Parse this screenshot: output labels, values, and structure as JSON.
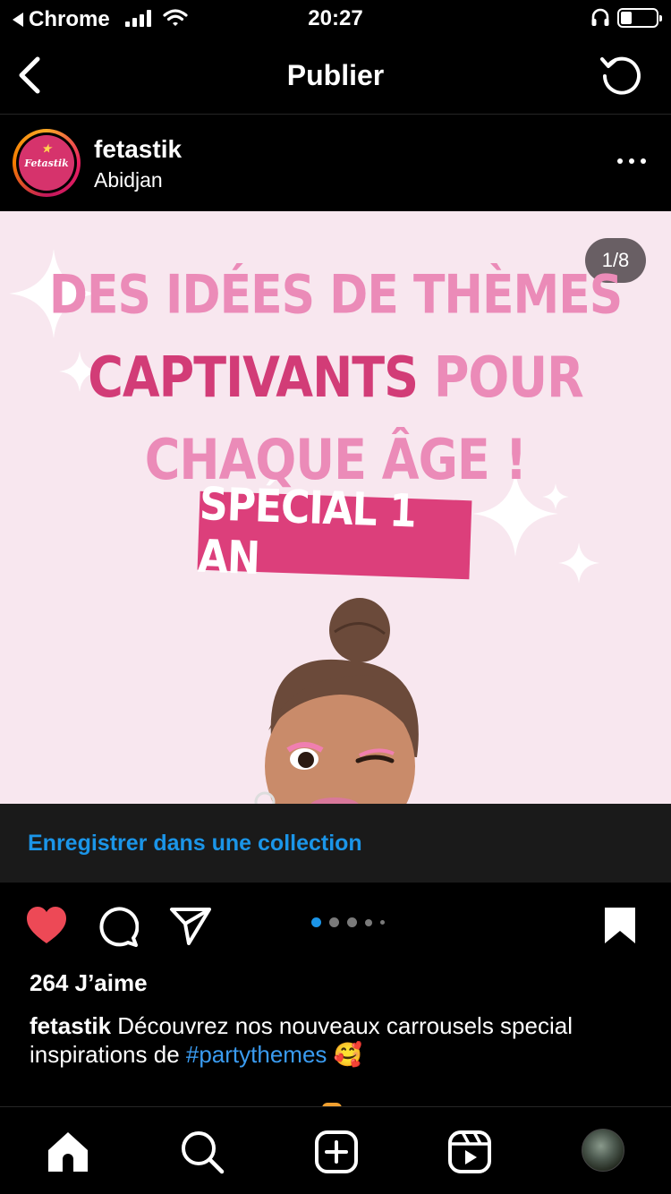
{
  "status_bar": {
    "back_app": "Chrome",
    "time": "20:27"
  },
  "nav": {
    "title": "Publier"
  },
  "post": {
    "username": "fetastik",
    "location": "Abidjan",
    "avatar_text": "Fetastik",
    "pager": "1/8",
    "image_text": {
      "line1": "DES IDÉES DE THÈMES",
      "line2_dark": "CAPTIVANTS",
      "line2_light": " POUR",
      "line3": "CHAQUE ÂGE !",
      "special": "SPÉCIAL 1 AN"
    },
    "carousel_dots": 5,
    "carousel_active_index": 0
  },
  "collection": {
    "label": "Enregistrer dans une collection"
  },
  "actions": {
    "liked": true,
    "saved": true
  },
  "meta": {
    "likes": "264 J’aime",
    "caption_user": "fetastik",
    "caption_text": " Découvrez nos nouveaux carrousels special inspirations de ",
    "caption_hashtag": "#partythemes",
    "caption_emoji": " 🥰"
  },
  "colors": {
    "accent_blue": "#1b95e8",
    "like_red": "#ed4956",
    "brand_pink": "#dc3f7b",
    "image_bg": "#f8e7ef"
  },
  "tab_bar": {
    "items": [
      "home-icon",
      "search-icon",
      "new-post-icon",
      "reels-icon",
      "profile-avatar"
    ]
  }
}
